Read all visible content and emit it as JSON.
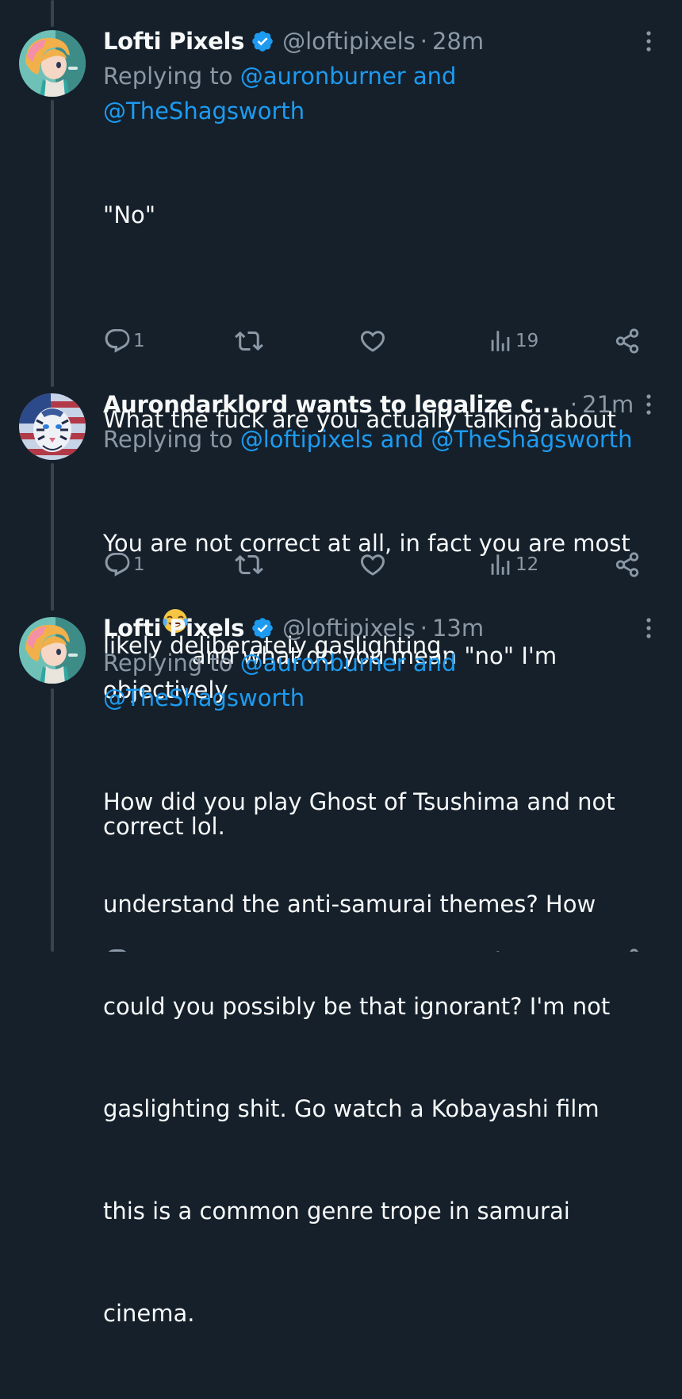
{
  "tweets": [
    {
      "author": {
        "name": "Lofti Pixels",
        "verified": true,
        "handle": "@loftipixels"
      },
      "separator": "·",
      "time": "28m",
      "replying": {
        "prefix": "Replying to",
        "mention1": "@auronburner",
        "and": "and",
        "mention2": "@TheShagsworth"
      },
      "text_lines": [
        "\"No\"",
        "",
        "What the fuck are you actually talking about"
      ],
      "text_after_emoji": "and what do you mean \"no\" I'm objectively",
      "text_last": "correct lol.",
      "emoji": "face-with-tears-of-joy",
      "stats": {
        "replies": "1",
        "views": "19"
      }
    },
    {
      "author": {
        "name": "Aurondarklord wants to legalize c...",
        "verified": false
      },
      "separator": "·",
      "time": "21m",
      "replying": {
        "prefix": "Replying to",
        "mention1": "@loftipixels",
        "and": "and",
        "mention2": "@TheShagsworth"
      },
      "text_lines": [
        "You are not correct at all, in fact you are most",
        "likely deliberately gaslighting."
      ],
      "stats": {
        "replies": "1",
        "views": "12"
      }
    },
    {
      "author": {
        "name": "Lofti Pixels",
        "verified": true,
        "handle": "@loftipixels"
      },
      "separator": "·",
      "time": "13m",
      "replying": {
        "prefix": "Replying to",
        "mention1": "@auronburner",
        "and": "and",
        "mention2": "@TheShagsworth"
      },
      "text_lines": [
        "How did you play Ghost of Tsushima and not",
        "understand the anti-samurai themes? How",
        "could you possibly be that ignorant? I'm not",
        "gaslighting shit. Go watch a Kobayashi film",
        "this is a common genre trope in samurai",
        "cinema."
      ]
    }
  ],
  "colors": {
    "background": "#15202b",
    "text": "#f7f9f9",
    "secondary": "#8b98a5",
    "link": "#1d9bf0",
    "thread_line": "#38444d",
    "verified": "#1d9bf0"
  },
  "icons": {
    "reply": "reply-bubble-icon",
    "retweet": "retweet-icon",
    "like": "heart-icon",
    "views": "views-bar-icon",
    "share": "share-icon",
    "more": "more-vertical-icon",
    "verified": "verified-badge-icon"
  }
}
